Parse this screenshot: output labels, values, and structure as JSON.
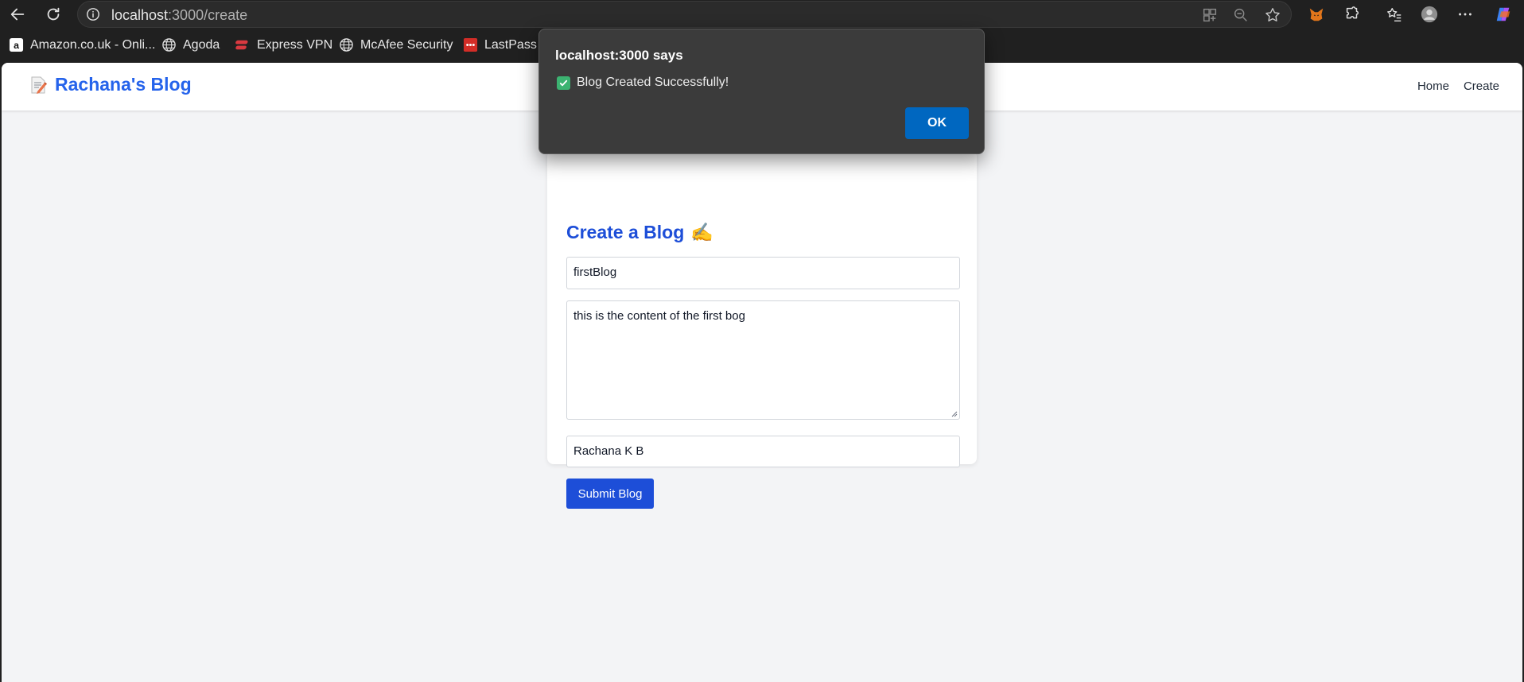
{
  "browser": {
    "url_host": "localhost",
    "url_path": ":3000/create",
    "bookmarks": [
      {
        "label": "Amazon.co.uk - Onli...",
        "icon": "amazon-icon"
      },
      {
        "label": "Agoda",
        "icon": "globe-icon"
      },
      {
        "label": "Express VPN",
        "icon": "expressvpn-icon"
      },
      {
        "label": "McAfee Security",
        "icon": "globe-icon"
      },
      {
        "label": "LastPass p",
        "icon": "lastpass-icon"
      }
    ]
  },
  "navbar": {
    "brand": "Rachana's Blog",
    "links": [
      "Home",
      "Create"
    ]
  },
  "form": {
    "heading": "Create a Blog",
    "heading_emoji": "✍️",
    "title_value": "firstBlog",
    "content_value": "this is the content of the first bog",
    "author_value": "Rachana K B",
    "submit_label": "Submit Blog"
  },
  "dialog": {
    "title": "localhost:3000 says",
    "message": "Blog Created Successfully!",
    "ok_label": "OK"
  },
  "colors": {
    "brand_blue": "#2563eb",
    "button_blue": "#1d4ed8",
    "dialog_ok": "#0067c0"
  }
}
